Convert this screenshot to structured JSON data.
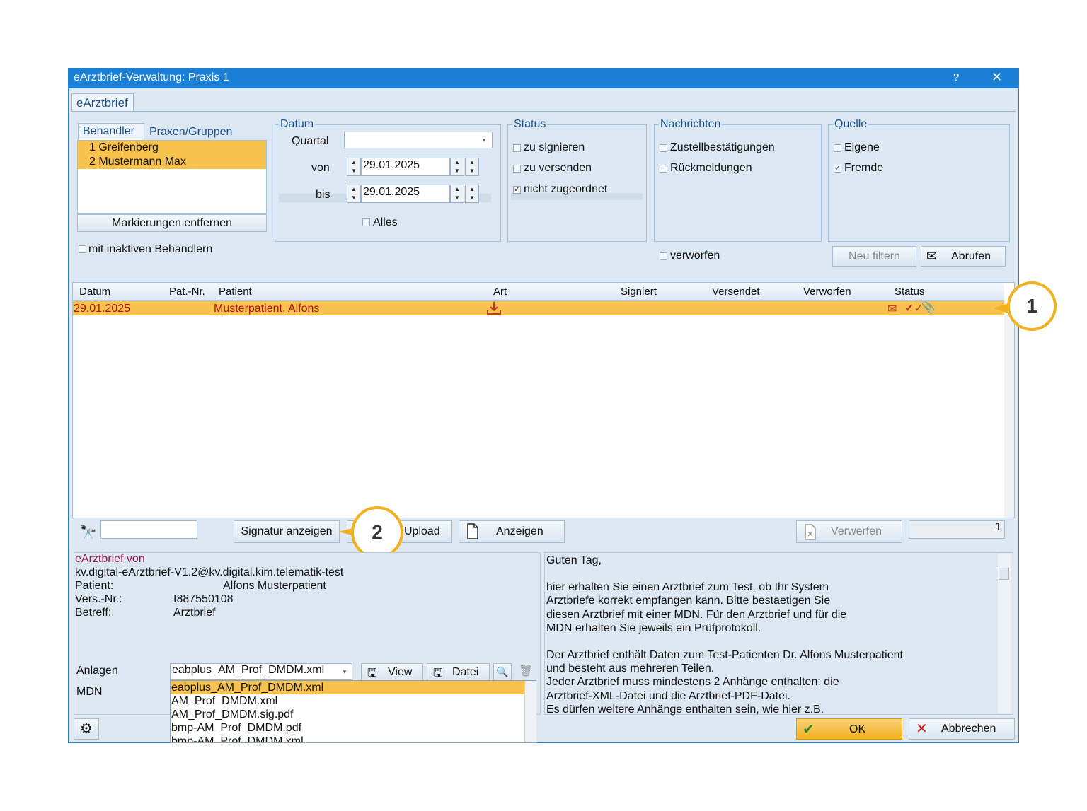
{
  "window": {
    "title": "eArztbrief-Verwaltung: Praxis 1",
    "help": "?",
    "close": "✕"
  },
  "tab_main": "eArztbrief",
  "behandler": {
    "tab1": "Behandler",
    "tab2": "Praxen/Gruppen",
    "items": [
      "1 Greifenberg",
      "2 Mustermann Max"
    ],
    "remove_btn": "Markierungen entfernen",
    "inactive_label": "mit inaktiven Behandlern"
  },
  "datum": {
    "group": "Datum",
    "quartal_label": "Quartal",
    "quartal_value": "",
    "von_label": "von",
    "von_value": "29.01.2025",
    "bis_label": "bis",
    "bis_value": "29.01.2025",
    "alles_label": "Alles"
  },
  "status": {
    "group": "Status",
    "items": [
      {
        "label": "zu signieren",
        "checked": false
      },
      {
        "label": "zu versenden",
        "checked": false
      },
      {
        "label": "nicht zugeordnet",
        "checked": true
      }
    ]
  },
  "nachrichten": {
    "group": "Nachrichten",
    "items": [
      {
        "label": "Zustellbestätigungen",
        "checked": false
      },
      {
        "label": "Rückmeldungen",
        "checked": false
      }
    ],
    "verworfen_label": "verworfen"
  },
  "quelle": {
    "group": "Quelle",
    "items": [
      {
        "label": "Eigene",
        "checked": false
      },
      {
        "label": "Fremde",
        "checked": true
      }
    ],
    "neu_filtern": "Neu filtern",
    "abrufen": "Abrufen"
  },
  "table": {
    "headers": [
      "Datum",
      "Pat.-Nr.",
      "Patient",
      "Art",
      "Signiert",
      "Versendet",
      "Verworfen",
      "Status"
    ],
    "rows": [
      {
        "datum": "29.01.2025",
        "patnr": "",
        "patient": "Musterpatient, Alfons"
      }
    ]
  },
  "toolbar": {
    "search_value": "",
    "signatur_btn": "Signatur anzeigen",
    "upload_btn": "Upload",
    "anzeigen_btn": "Anzeigen",
    "verwerfen_btn": "Verwerfen",
    "counter": "1"
  },
  "detail": {
    "from_label": "eArztbrief von",
    "from_address": "kv.digital-eArztbrief-V1.2@kv.digital.kim.telematik-test",
    "patient_label": "Patient:",
    "patient_value": "Alfons Musterpatient",
    "vers_label": "Vers.-Nr.:",
    "vers_value": "I887550108",
    "betreff_label": "Betreff:",
    "betreff_value": "Arztbrief",
    "anlagen_label": "Anlagen",
    "mdn_label": "MDN",
    "anlagen_value": "eabplus_AM_Prof_DMDM.xml",
    "view_btn": "View",
    "datei_btn": "Datei",
    "dropdown": [
      "eabplus_AM_Prof_DMDM.xml",
      "AM_Prof_DMDM.xml",
      "AM_Prof_DMDM.sig.pdf",
      "bmp-AM_Prof_DMDM.pdf",
      "bmp-AM_Prof_DMDM.xml"
    ]
  },
  "message": {
    "lines": [
      "Guten Tag,",
      "",
      "hier erhalten Sie einen Arztbrief zum Test, ob Ihr System",
      "Arztbriefe korrekt empfangen kann. Bitte bestaetigen Sie",
      "diesen Arztbrief mit einer MDN. Für den Arztbrief und für die",
      "MDN erhalten Sie jeweils ein Prüfprotokoll.",
      "",
      "Der Arztbrief enthält Daten zum Test-Patienten Dr. Alfons Musterpatient",
      "und besteht aus mehreren Teilen.",
      "Jeder Arztbrief muss mindestens 2 Anhänge enthalten: die",
      "Arztbrief-XML-Datei und die Arztbrief-PDF-Datei.",
      "Es dürfen weitere Anhänge enthalten sein, wie hier z.B."
    ]
  },
  "footer": {
    "ok": "OK",
    "abbrechen": "Abbrechen"
  },
  "callouts": [
    "1",
    "2"
  ],
  "colors": {
    "titlebar": "#1b7fd6",
    "selection": "#f7c24e",
    "callout": "#f2b01c",
    "red_text": "#b01010"
  }
}
